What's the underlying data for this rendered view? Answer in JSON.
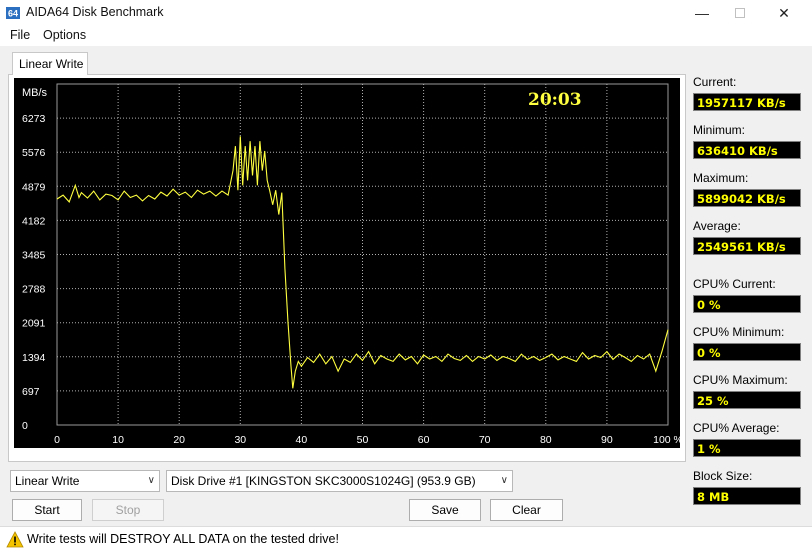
{
  "window": {
    "title": "AIDA64 Disk Benchmark"
  },
  "menu": {
    "items": [
      "File",
      "Options"
    ]
  },
  "tab": {
    "label": "Linear Write"
  },
  "chart_data": {
    "type": "line",
    "ylabel": "MB/s",
    "elapsed_time": "20:03",
    "y_ticks": [
      "0",
      "697",
      "1394",
      "2091",
      "2788",
      "3485",
      "4182",
      "4879",
      "5576",
      "6273"
    ],
    "x_ticks": [
      "0",
      "10",
      "20",
      "30",
      "40",
      "50",
      "60",
      "70",
      "80",
      "90",
      "100 %"
    ],
    "ylim": [
      0,
      6970
    ],
    "xlim": [
      0,
      100
    ],
    "grid": true,
    "line_color": "#ffff40",
    "series": [
      {
        "values": [
          [
            0,
            4620
          ],
          [
            1,
            4700
          ],
          [
            2,
            4560
          ],
          [
            3,
            4900
          ],
          [
            3.6,
            4650
          ],
          [
            4,
            4750
          ],
          [
            5,
            4640
          ],
          [
            6,
            4780
          ],
          [
            7,
            4600
          ],
          [
            8,
            4720
          ],
          [
            9,
            4690
          ],
          [
            10,
            4600
          ],
          [
            11,
            4780
          ],
          [
            12,
            4650
          ],
          [
            13,
            4700
          ],
          [
            14,
            4580
          ],
          [
            15,
            4690
          ],
          [
            16,
            4620
          ],
          [
            17,
            4760
          ],
          [
            18,
            4680
          ],
          [
            19,
            4820
          ],
          [
            20,
            4700
          ],
          [
            21,
            4760
          ],
          [
            22,
            4650
          ],
          [
            23,
            4800
          ],
          [
            24,
            4720
          ],
          [
            25,
            4780
          ],
          [
            26,
            4680
          ],
          [
            27,
            4780
          ],
          [
            28,
            4700
          ],
          [
            28.8,
            5200
          ],
          [
            29.2,
            5700
          ],
          [
            29.6,
            4800
          ],
          [
            30,
            5900
          ],
          [
            30.4,
            4900
          ],
          [
            30.8,
            5700
          ],
          [
            31.2,
            5000
          ],
          [
            31.6,
            5800
          ],
          [
            32,
            5100
          ],
          [
            32.4,
            5700
          ],
          [
            32.8,
            4900
          ],
          [
            33.2,
            5800
          ],
          [
            33.6,
            5200
          ],
          [
            34,
            5600
          ],
          [
            34.4,
            5000
          ],
          [
            34.8,
            4800
          ],
          [
            35.3,
            4500
          ],
          [
            35.8,
            4800
          ],
          [
            36.3,
            4300
          ],
          [
            36.8,
            4750
          ],
          [
            37.3,
            3200
          ],
          [
            37.8,
            2100
          ],
          [
            38.3,
            1200
          ],
          [
            38.6,
            750
          ],
          [
            39,
            1100
          ],
          [
            39.5,
            1300
          ],
          [
            40,
            1200
          ],
          [
            41,
            1380
          ],
          [
            42,
            1280
          ],
          [
            43,
            1450
          ],
          [
            44,
            1250
          ],
          [
            45,
            1400
          ],
          [
            46,
            1100
          ],
          [
            47,
            1350
          ],
          [
            48,
            1280
          ],
          [
            49,
            1450
          ],
          [
            50,
            1320
          ],
          [
            51,
            1500
          ],
          [
            52,
            1250
          ],
          [
            53,
            1420
          ],
          [
            54,
            1350
          ],
          [
            55,
            1300
          ],
          [
            56,
            1450
          ],
          [
            57,
            1330
          ],
          [
            58,
            1400
          ],
          [
            59,
            1250
          ],
          [
            60,
            1430
          ],
          [
            61,
            1350
          ],
          [
            62,
            1400
          ],
          [
            63,
            1300
          ],
          [
            64,
            1450
          ],
          [
            65,
            1360
          ],
          [
            66,
            1320
          ],
          [
            67,
            1420
          ],
          [
            68,
            1300
          ],
          [
            69,
            1400
          ],
          [
            70,
            1350
          ],
          [
            71,
            1430
          ],
          [
            72,
            1320
          ],
          [
            73,
            1400
          ],
          [
            74,
            1360
          ],
          [
            75,
            1300
          ],
          [
            76,
            1450
          ],
          [
            77,
            1340
          ],
          [
            78,
            1400
          ],
          [
            79,
            1320
          ],
          [
            80,
            1380
          ],
          [
            81,
            1450
          ],
          [
            82,
            1330
          ],
          [
            83,
            1400
          ],
          [
            84,
            1350
          ],
          [
            85,
            1300
          ],
          [
            86,
            1480
          ],
          [
            87,
            1350
          ],
          [
            88,
            1420
          ],
          [
            89,
            1380
          ],
          [
            90,
            1500
          ],
          [
            91,
            1340
          ],
          [
            92,
            1450
          ],
          [
            93,
            1380
          ],
          [
            94,
            1300
          ],
          [
            95,
            1420
          ],
          [
            96,
            1350
          ],
          [
            97,
            1450
          ],
          [
            98,
            1100
          ],
          [
            99,
            1500
          ],
          [
            100,
            1950
          ]
        ]
      }
    ]
  },
  "stats": {
    "current_label": "Current:",
    "current_value": "1957117 KB/s",
    "minimum_label": "Minimum:",
    "minimum_value": "636410 KB/s",
    "maximum_label": "Maximum:",
    "maximum_value": "5899042 KB/s",
    "average_label": "Average:",
    "average_value": "2549561 KB/s",
    "cpu_current_label": "CPU% Current:",
    "cpu_current_value": "0 %",
    "cpu_minimum_label": "CPU% Minimum:",
    "cpu_minimum_value": "0 %",
    "cpu_maximum_label": "CPU% Maximum:",
    "cpu_maximum_value": "25 %",
    "cpu_average_label": "CPU% Average:",
    "cpu_average_value": "1 %",
    "block_size_label": "Block Size:",
    "block_size_value": "8 MB"
  },
  "controls": {
    "test_select": "Linear Write",
    "drive_select": "Disk Drive #1  [KINGSTON SKC3000S1024G]  (953.9 GB)",
    "start": "Start",
    "stop": "Stop",
    "save": "Save",
    "clear": "Clear"
  },
  "status": {
    "warning": "Write tests will DESTROY ALL DATA on the tested drive!"
  }
}
